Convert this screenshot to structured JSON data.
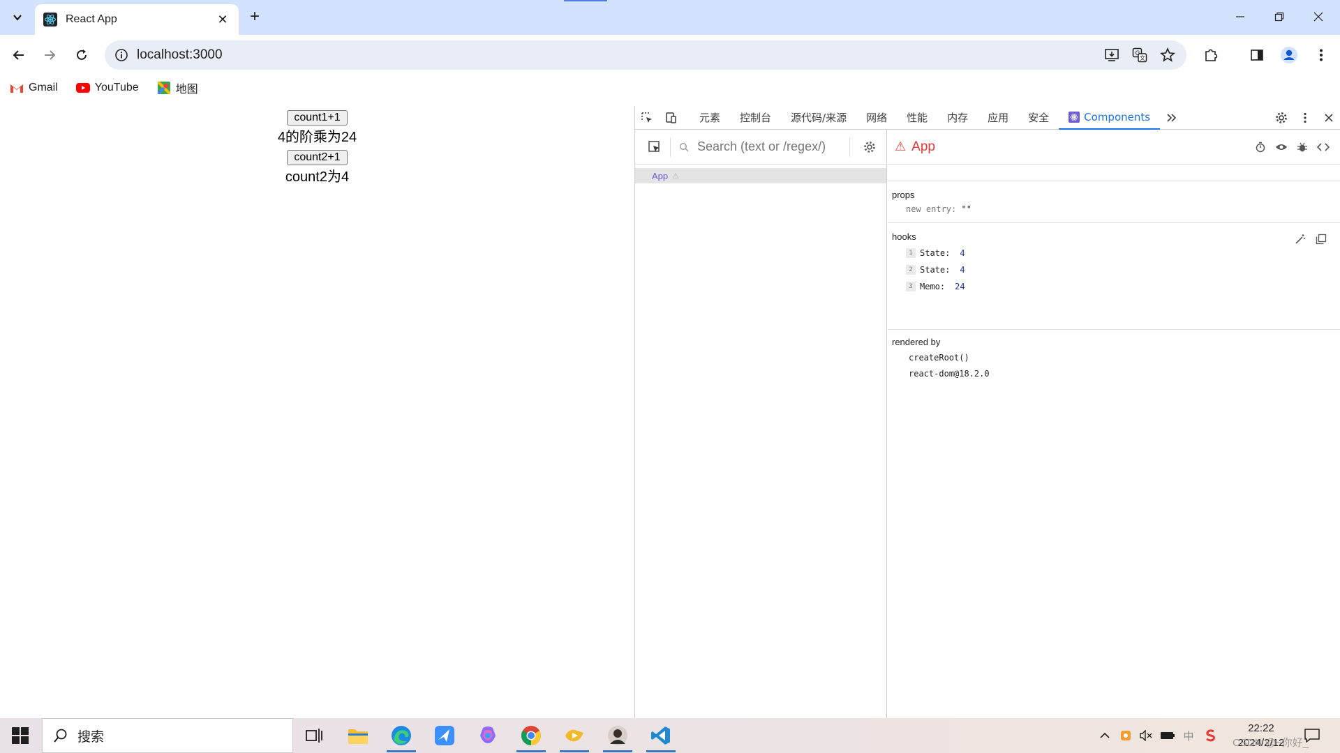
{
  "browser": {
    "tab_title": "React App",
    "url": "localhost:3000",
    "bookmarks": [
      {
        "label": "Gmail",
        "icon": "gmail-icon"
      },
      {
        "label": "YouTube",
        "icon": "youtube-icon"
      },
      {
        "label": "地图",
        "icon": "maps-icon"
      }
    ]
  },
  "app": {
    "button1_label": "count1+1",
    "line1": "4的阶乘为24",
    "button2_label": "count2+1",
    "line2": "count2为4"
  },
  "devtools": {
    "tabs": [
      "元素",
      "控制台",
      "源代码/来源",
      "网络",
      "性能",
      "内存",
      "应用",
      "安全"
    ],
    "active_tab": "Components",
    "search_placeholder": "Search (text or /regex/)",
    "tree_item": "App",
    "selected_component": "App",
    "props_title": "props",
    "props_key": "new entry",
    "props_value": "\"\"",
    "hooks_title": "hooks",
    "hooks": [
      {
        "index": "1",
        "name": "State:",
        "value": "4"
      },
      {
        "index": "2",
        "name": "State:",
        "value": "4"
      },
      {
        "index": "3",
        "name": "Memo:",
        "value": "24"
      }
    ],
    "rendered_by_title": "rendered by",
    "rendered_by": [
      "createRoot()",
      "react-dom@18.2.0"
    ]
  },
  "taskbar": {
    "search_text": "搜索",
    "time": "22:22",
    "date": "2024/2/12",
    "ime": "中",
    "watermark": "CSDN @~你好_"
  },
  "colors": {
    "tabstrip": "#d3e3fd",
    "devtools_accent": "#1a73e8",
    "component_red": "#e53935",
    "hook_value": "#1e2fa8"
  }
}
